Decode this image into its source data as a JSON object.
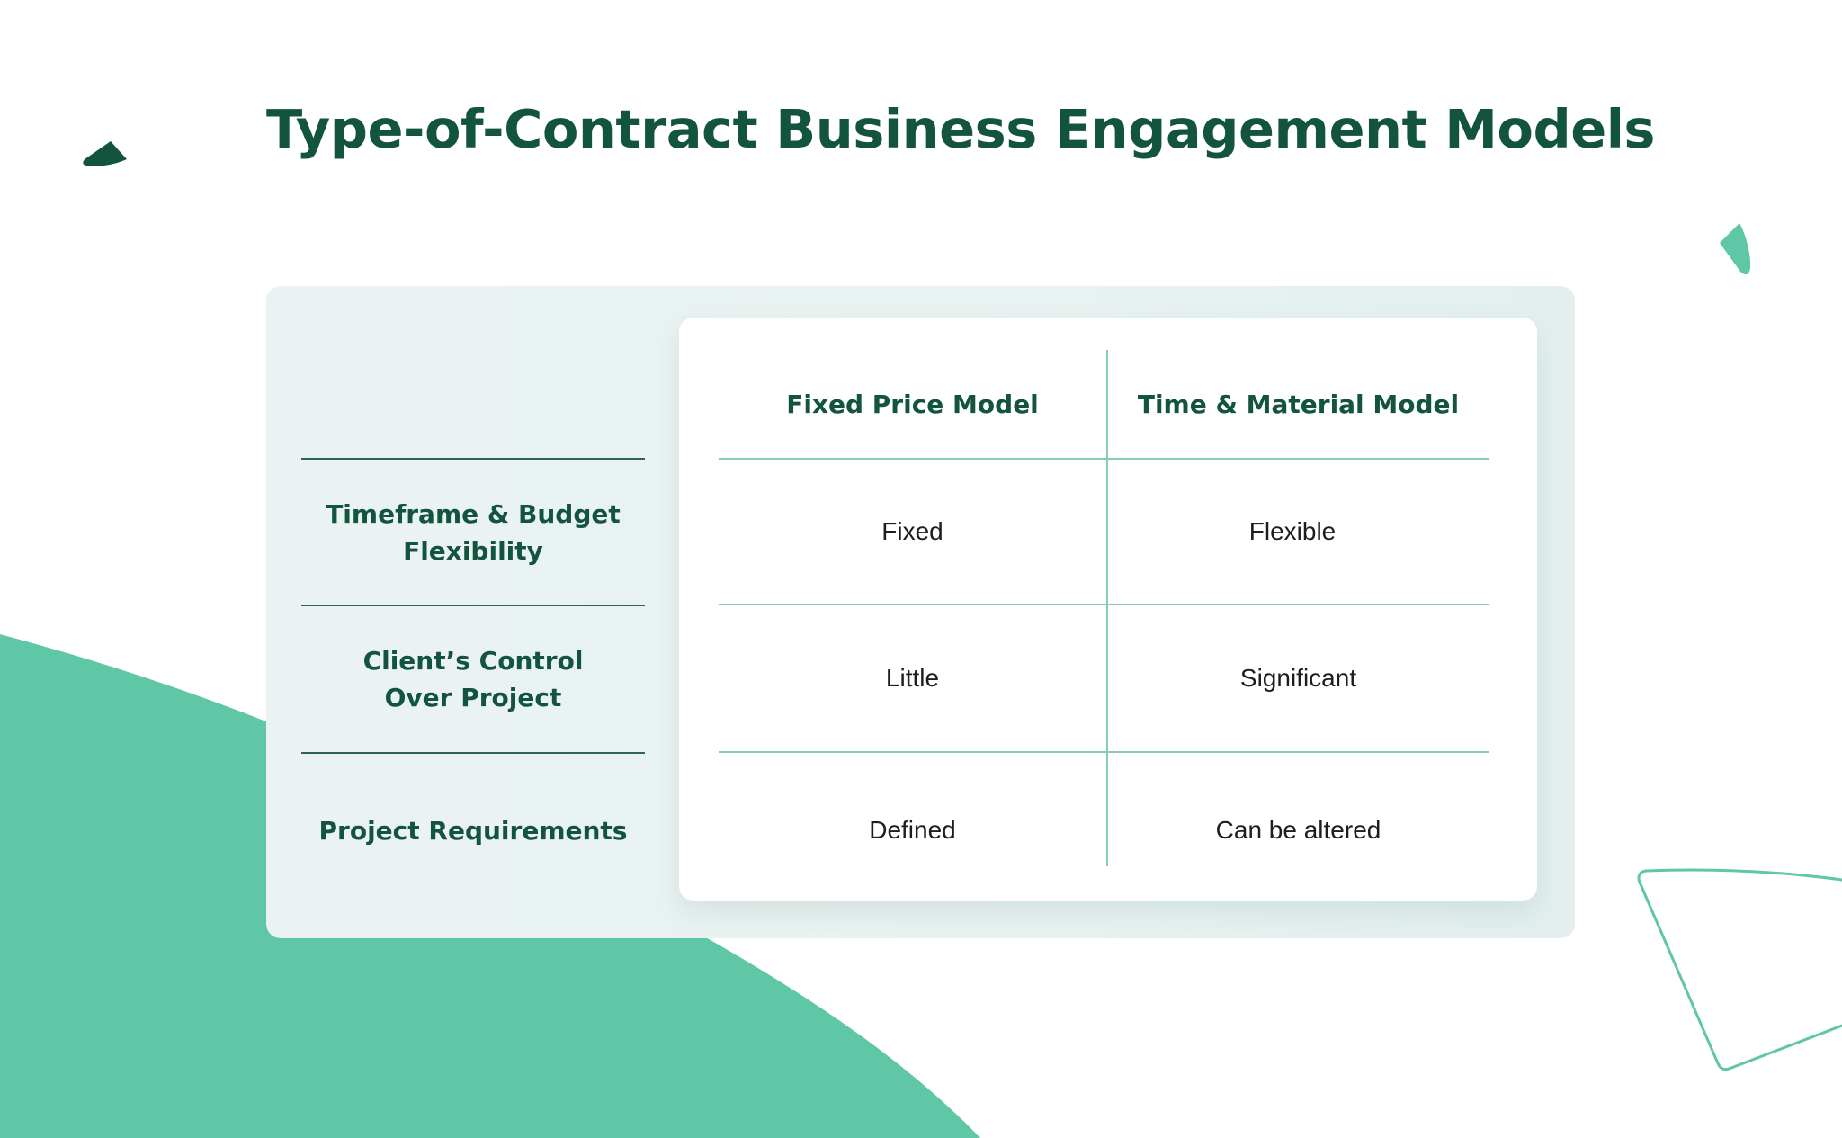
{
  "title": "Type-of-Contract Business Engagement Models",
  "colors": {
    "title": "#12543f",
    "accent_green": "#5fc7a6",
    "dark_green": "#12543f",
    "panel_bg": "#e8f2f1",
    "grid_line": "#86cdb6"
  },
  "decorations": [
    {
      "name": "dark-green-leaf-shape"
    },
    {
      "name": "mint-leaf-shape"
    },
    {
      "name": "mint-outline-wedge-shape"
    },
    {
      "name": "mint-background-blob"
    }
  ],
  "table": {
    "columns": [
      "Fixed Price Model",
      "Time & Material Model"
    ],
    "rows": [
      {
        "label": "Timeframe & Budget Flexibility",
        "label_lines": [
          "Timeframe & Budget",
          "Flexibility"
        ],
        "values": [
          "Fixed",
          "Flexible"
        ]
      },
      {
        "label": "Client’s Control Over Project",
        "label_lines": [
          "Client’s Control",
          "Over Project"
        ],
        "values": [
          "Little",
          "Significant"
        ]
      },
      {
        "label": "Project Requirements",
        "label_lines": [
          "Project Requirements"
        ],
        "values": [
          "Defined",
          "Can be altered"
        ]
      }
    ]
  }
}
